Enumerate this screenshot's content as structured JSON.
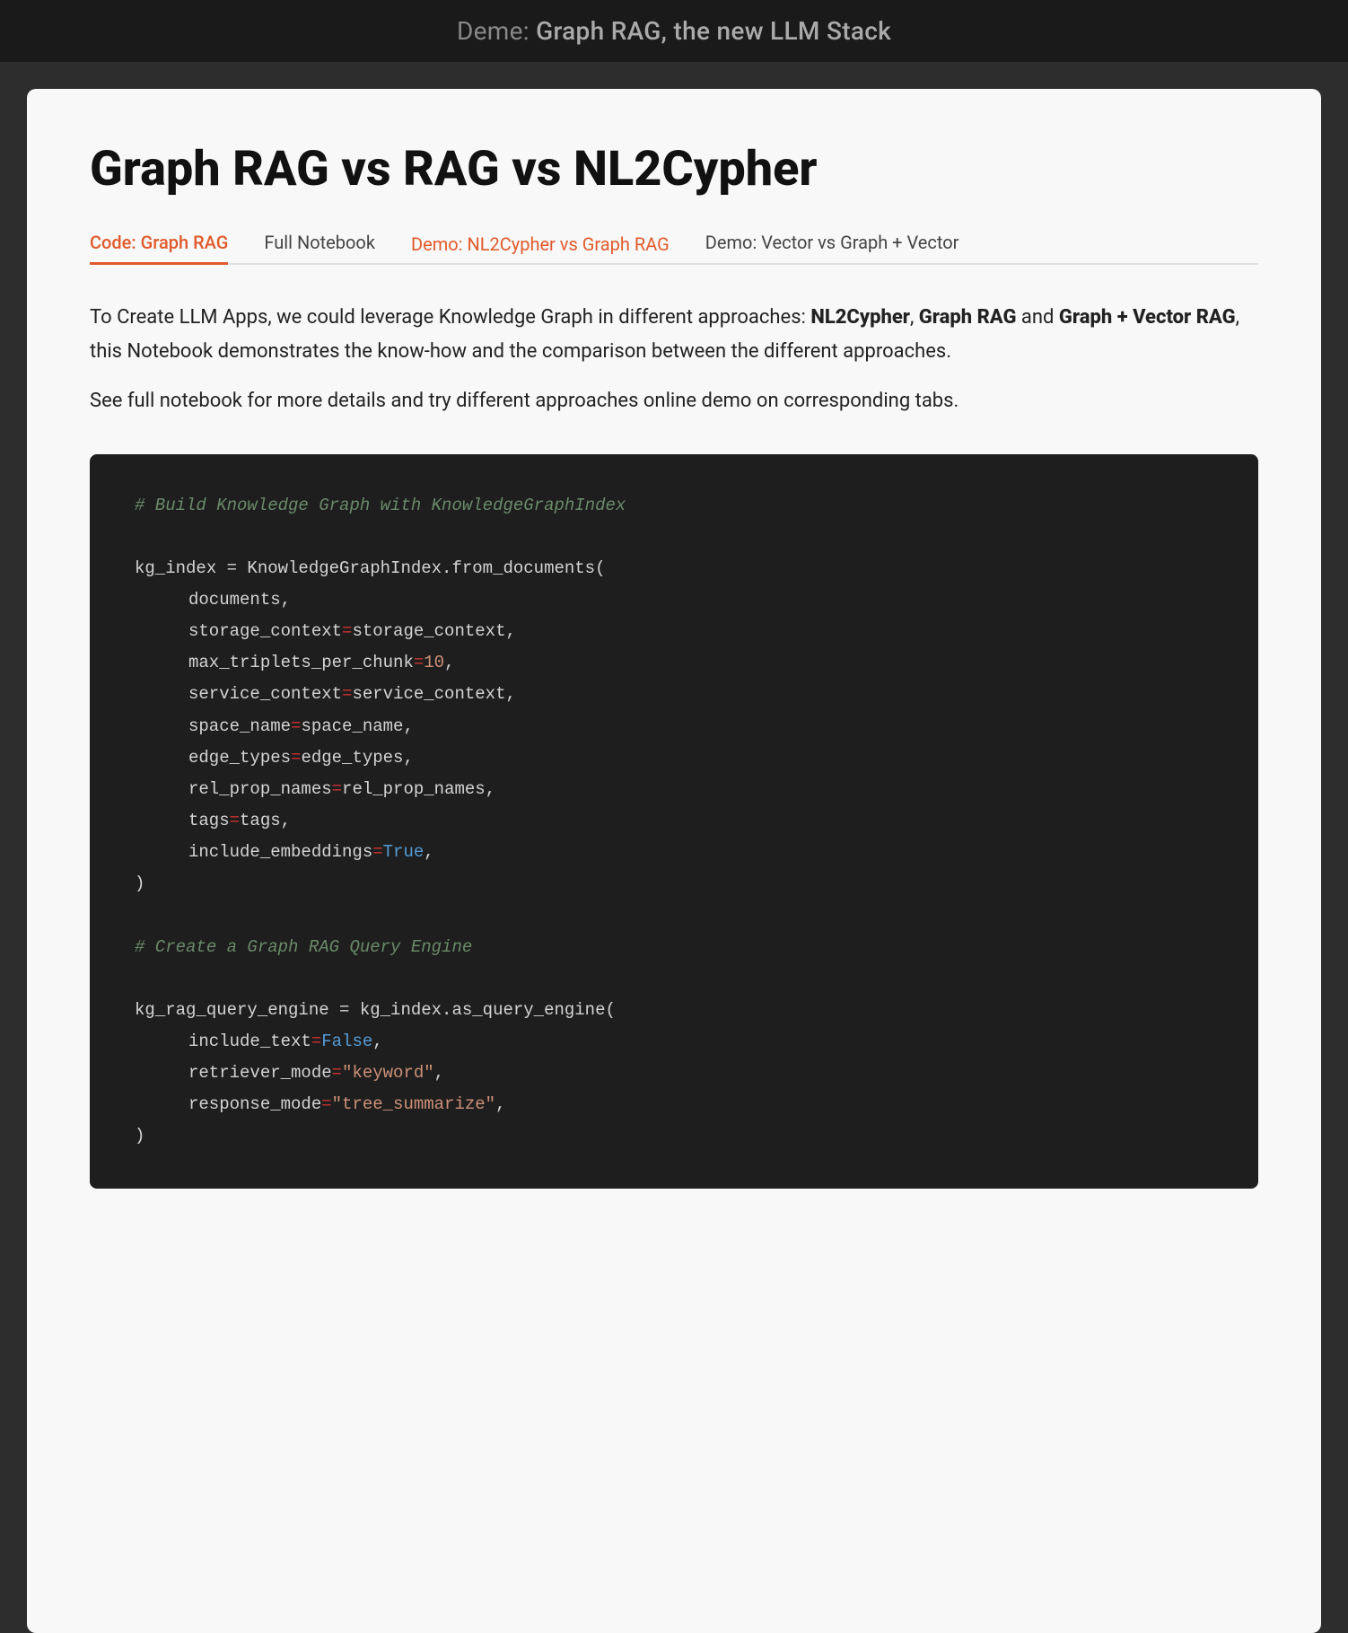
{
  "topBar": {
    "prefix": "Deme: ",
    "title": "Graph RAG, the new LLM Stack"
  },
  "page": {
    "title": "Graph RAG vs RAG vs NL2Cypher"
  },
  "tabs": [
    {
      "id": "code-graph-rag",
      "label": "Code: Graph RAG",
      "active": true
    },
    {
      "id": "full-notebook",
      "label": "Full Notebook",
      "active": false
    },
    {
      "id": "demo-nl2cypher",
      "label": "Demo: NL2Cypher vs Graph RAG",
      "active": false,
      "hovered": true
    },
    {
      "id": "demo-vector",
      "label": "Demo: Vector vs Graph + Vector",
      "active": false
    }
  ],
  "description": {
    "paragraph1_start": "To Create LLM Apps, we could leverage Knowledge Graph in different approaches: ",
    "bold1": "NL2Cypher",
    "comma1": ", ",
    "bold2": "Graph RAG",
    "and_text": " and ",
    "bold3": "Graph + Vector RAG",
    "paragraph1_end": ", this Notebook demonstrates the know-how and the comparison between the different approaches.",
    "paragraph2": "See full notebook for more details and try different approaches online demo on corresponding tabs."
  },
  "codeBlock": {
    "comment1": "# Build Knowledge Graph with KnowledgeGraphIndex",
    "line1": "kg_index = KnowledgeGraphIndex.from_documents(",
    "line2_indent": "documents,",
    "line3_key": "storage_context",
    "line3_val": "storage_context",
    "line4_key": "max_triplets_per_chunk",
    "line4_val": "10",
    "line5_key": "service_context",
    "line5_val": "service_context",
    "line6_key": "space_name",
    "line6_val": "space_name",
    "line7_key": "edge_types",
    "line7_val": "edge_types",
    "line8_key": "rel_prop_names",
    "line8_val": "rel_prop_names",
    "line9_key": "tags",
    "line9_val": "tags",
    "line10_key": "include_embeddings",
    "line10_val": "True",
    "close1": ")",
    "comment2": "# Create a Graph RAG Query Engine",
    "line11": "kg_rag_query_engine = kg_index.as_query_engine(",
    "line12_key": "include_text",
    "line12_val": "False",
    "line13_key": "retriever_mode",
    "line13_val": "\"keyword\"",
    "line14_key": "response_mode",
    "line14_val": "\"tree_summarize\"",
    "close2": ")"
  }
}
